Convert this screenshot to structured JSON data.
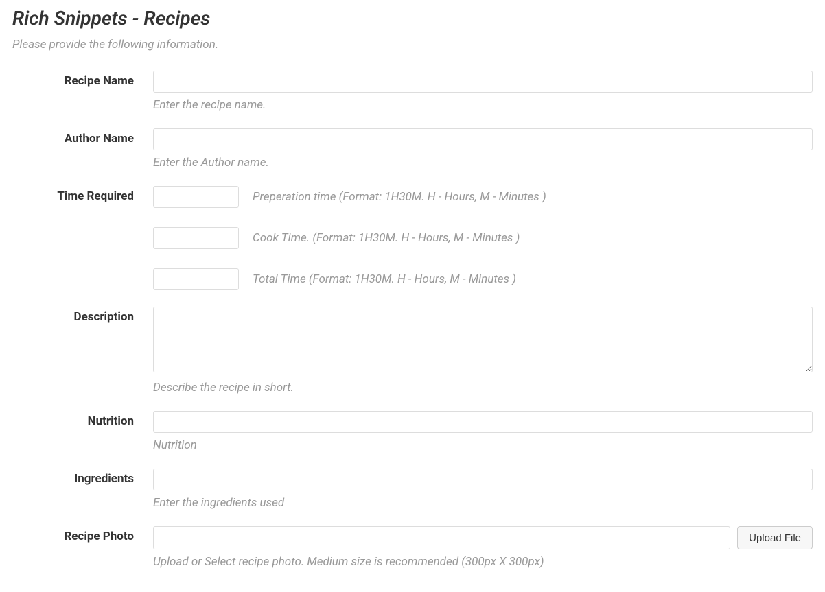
{
  "header": {
    "title": "Rich Snippets - Recipes",
    "subtitle": "Please provide the following information."
  },
  "fields": {
    "recipe_name": {
      "label": "Recipe Name",
      "value": "",
      "help": "Enter the recipe name."
    },
    "author_name": {
      "label": "Author Name",
      "value": "",
      "help": "Enter the Author name."
    },
    "time_required": {
      "label": "Time Required",
      "prep": {
        "value": "",
        "help": "Preperation time (Format: 1H30M. H - Hours, M - Minutes )"
      },
      "cook": {
        "value": "",
        "help": "Cook Time. (Format: 1H30M. H - Hours, M - Minutes )"
      },
      "total": {
        "value": "",
        "help": "Total Time (Format: 1H30M. H - Hours, M - Minutes )"
      }
    },
    "description": {
      "label": "Description",
      "value": "",
      "help": "Describe the recipe in short."
    },
    "nutrition": {
      "label": "Nutrition",
      "value": "",
      "help": "Nutrition"
    },
    "ingredients": {
      "label": "Ingredients",
      "value": "",
      "help": "Enter the ingredients used"
    },
    "recipe_photo": {
      "label": "Recipe Photo",
      "value": "",
      "button": "Upload File",
      "help": "Upload or Select recipe photo. Medium size is recommended (300px X 300px)"
    }
  }
}
